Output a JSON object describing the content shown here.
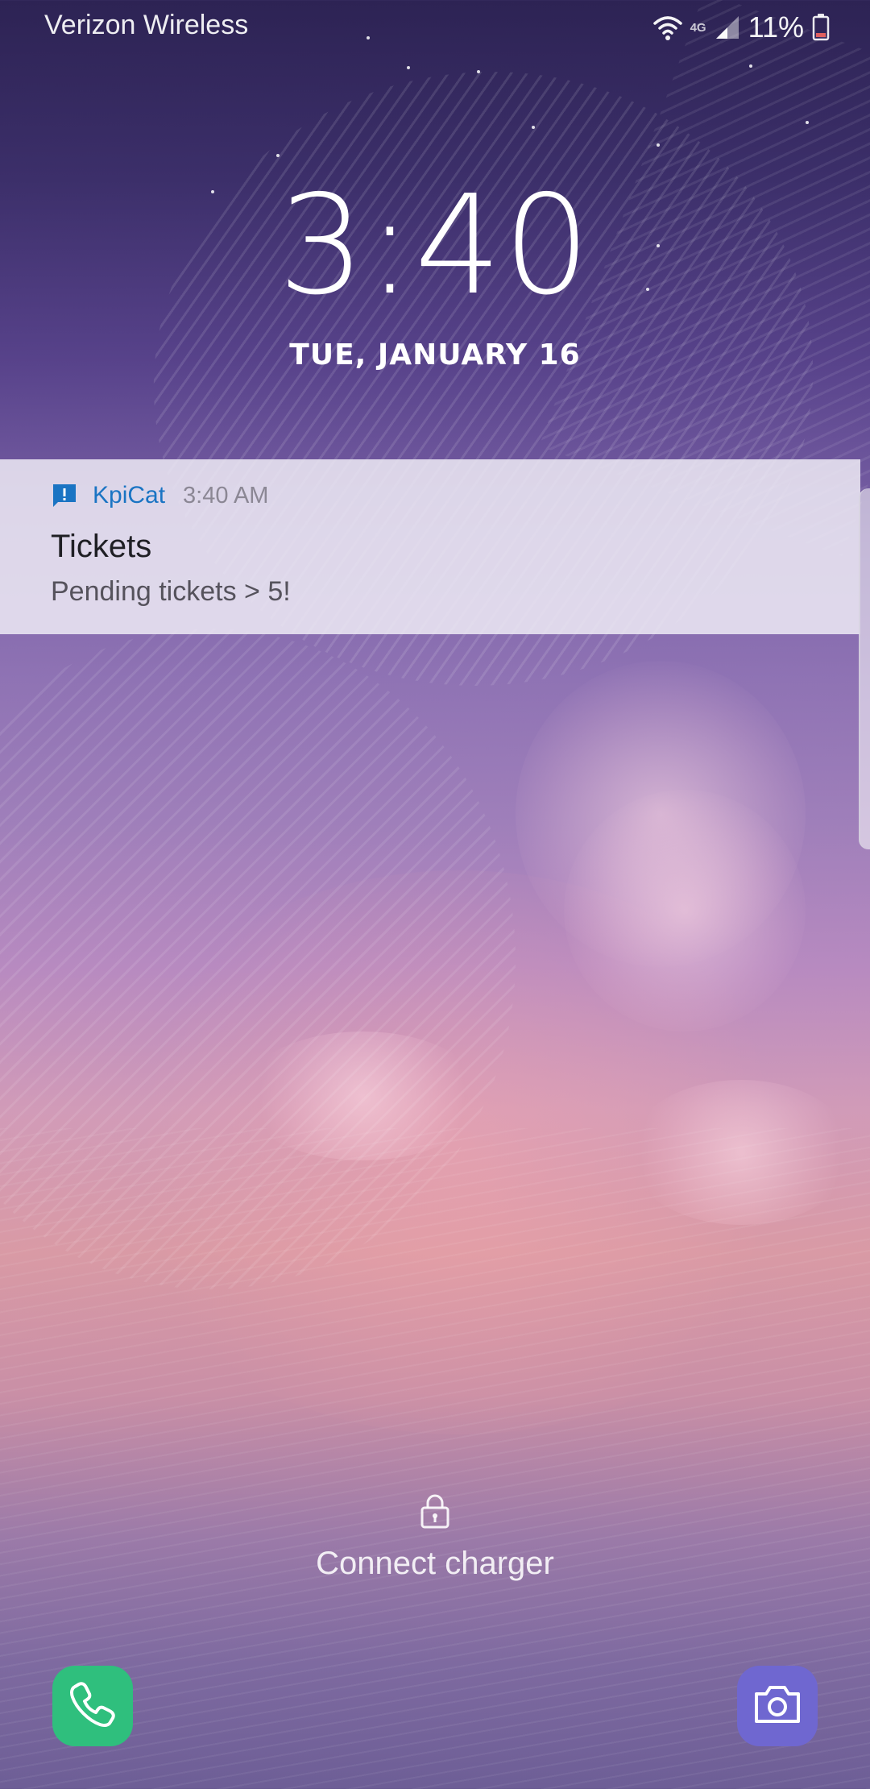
{
  "status_bar": {
    "carrier": "Verizon Wireless",
    "network_label": "4G",
    "battery_percent": "11%",
    "icons": [
      "wifi-icon",
      "network-4g-icon",
      "signal-icon",
      "battery-icon"
    ]
  },
  "lockscreen": {
    "time": "3:40",
    "date": "TUE, JANUARY 16"
  },
  "notification": {
    "app_name": "KpiCat",
    "time": "3:40 AM",
    "title": "Tickets",
    "body": "Pending tickets > 5!",
    "app_icon": "message-alert-icon",
    "accent_color": "#1a74c3"
  },
  "footer": {
    "lock_icon": "lock-icon",
    "charger_text": "Connect charger",
    "shortcuts": [
      {
        "name": "phone",
        "icon": "phone-icon",
        "color": "#2fbf7d"
      },
      {
        "name": "camera",
        "icon": "camera-icon",
        "color": "#6f67d0"
      }
    ]
  }
}
